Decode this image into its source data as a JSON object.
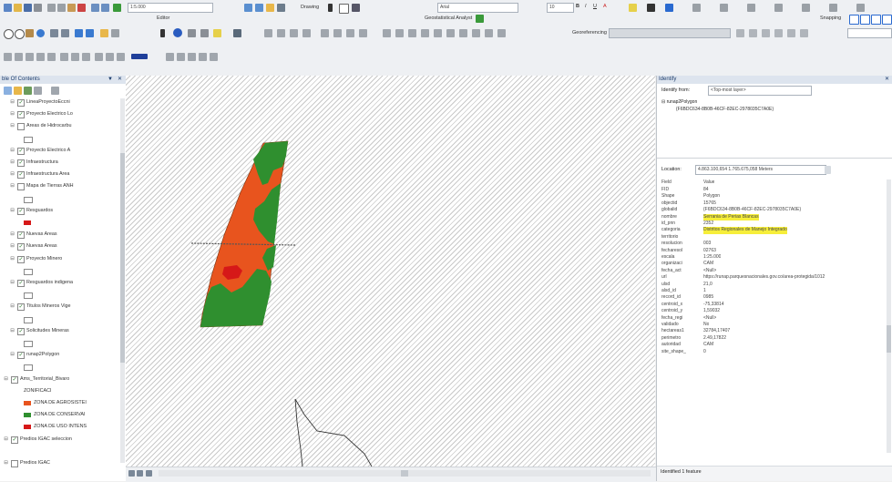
{
  "toolbar": {
    "scale": "1:5.000",
    "drawing_label": "Drawing",
    "font_value": "Arial",
    "font_size": "10",
    "editor_label": "Editor",
    "geostatistical_label": "Geostatistical Analyst",
    "snapping_label": "Snapping",
    "georeferencing_label": "Georeferencing"
  },
  "toc": {
    "title": "ble Of Contents",
    "layers": [
      {
        "label": "LineaProyectoEccni",
        "checked": true,
        "expanded": true,
        "indent": 1
      },
      {
        "label": "Proyecto Electrico Lo",
        "checked": true,
        "expanded": true,
        "indent": 1
      },
      {
        "label": "Areas de Hidrocarbu",
        "checked": false,
        "expanded": true,
        "indent": 1
      },
      {
        "label": "",
        "checked": null,
        "expanded": null,
        "indent": 2,
        "symbol": "outline"
      },
      {
        "label": "Proyecto Electrico A",
        "checked": true,
        "expanded": true,
        "indent": 1
      },
      {
        "label": "Infraestructura",
        "checked": true,
        "expanded": true,
        "indent": 1
      },
      {
        "label": "Infraestructura Area",
        "checked": true,
        "expanded": true,
        "indent": 1
      },
      {
        "label": "Mapa de Tierras ANH",
        "checked": false,
        "expanded": true,
        "indent": 1
      },
      {
        "label": "",
        "checked": null,
        "expanded": null,
        "indent": 2,
        "symbol": "outline"
      },
      {
        "label": "Resguardos",
        "checked": true,
        "expanded": true,
        "indent": 1
      },
      {
        "label": "",
        "checked": null,
        "expanded": null,
        "indent": 2,
        "symbol": "red"
      },
      {
        "label": "Nuevas Areas",
        "checked": true,
        "expanded": true,
        "indent": 1
      },
      {
        "label": "Nuevas Areas",
        "checked": true,
        "expanded": true,
        "indent": 1
      },
      {
        "label": "Proyecto Minero",
        "checked": true,
        "expanded": true,
        "indent": 1
      },
      {
        "label": "",
        "checked": null,
        "expanded": null,
        "indent": 2,
        "symbol": "outline"
      },
      {
        "label": "Resguardos indigena",
        "checked": true,
        "expanded": true,
        "indent": 1
      },
      {
        "label": "",
        "checked": null,
        "expanded": null,
        "indent": 2,
        "symbol": "outline"
      },
      {
        "label": "Titulos Mineros Vige",
        "checked": true,
        "expanded": true,
        "indent": 1
      },
      {
        "label": "",
        "checked": null,
        "expanded": null,
        "indent": 2,
        "symbol": "outline"
      },
      {
        "label": "Solicitudes Mineras",
        "checked": true,
        "expanded": true,
        "indent": 1
      },
      {
        "label": "",
        "checked": null,
        "expanded": null,
        "indent": 2,
        "symbol": "outline"
      },
      {
        "label": "runap2Polygon",
        "checked": true,
        "expanded": true,
        "indent": 1
      },
      {
        "label": "",
        "checked": null,
        "expanded": null,
        "indent": 2,
        "symbol": "outline"
      },
      {
        "label": "Ams_Territorial_Bivaro",
        "checked": true,
        "expanded": true,
        "indent": 0
      },
      {
        "label": "ZONIFICACI",
        "checked": null,
        "expanded": null,
        "indent": 2,
        "symbol": null
      },
      {
        "label": "ZONA DE AGROSISTEI",
        "checked": null,
        "expanded": null,
        "indent": 2,
        "symbol": "orange"
      },
      {
        "label": "ZONA DE CONSERVAI",
        "checked": null,
        "expanded": null,
        "indent": 2,
        "symbol": "green"
      },
      {
        "label": "ZONA DE USO INTENS",
        "checked": null,
        "expanded": null,
        "indent": 2,
        "symbol": "red"
      },
      {
        "label": "Predios IGAC seleccion",
        "checked": true,
        "expanded": true,
        "indent": 0
      },
      {
        "label": "",
        "checked": null,
        "expanded": null,
        "indent": 0,
        "symbol": null
      },
      {
        "label": "Predios IGAC",
        "checked": false,
        "expanded": true,
        "indent": 0
      }
    ]
  },
  "identify": {
    "title": "Identify",
    "identify_from_label": "Identify from:",
    "identify_from_value": "<Top-most layer>",
    "tree_layer": "runap2Polygon",
    "tree_feature": "{F6BDC634-8B0B-46CF-82EC-2978035C7A0E}",
    "location_label": "Location:",
    "location_value": "4.863.100,654  1.765.675,058 Meters",
    "field_header": "Field",
    "value_header": "Value",
    "rows": [
      {
        "field": "FID",
        "value": "84"
      },
      {
        "field": "Shape",
        "value": "Polygon"
      },
      {
        "field": "objectid",
        "value": "15765"
      },
      {
        "field": "globalid",
        "value": "{F6BDC634-8B0B-46CF-82EC-2978035C7A0E}"
      },
      {
        "field": "nombre",
        "value": "Serrania de Perias Blancas",
        "highlight": true
      },
      {
        "field": "id_pnn",
        "value": "2352"
      },
      {
        "field": "categoria",
        "value": "Distritos Regionales de Manejo Integrado",
        "highlight": true
      },
      {
        "field": "territorio",
        "value": ""
      },
      {
        "field": "resolucion",
        "value": "003"
      },
      {
        "field": "fecharesol",
        "value": "02763"
      },
      {
        "field": "escala",
        "value": "1:25.000"
      },
      {
        "field": "organizaci",
        "value": "CAM"
      },
      {
        "field": "fecha_act",
        "value": "<Null>"
      },
      {
        "field": "url",
        "value": "https://runap.parquesnacionales.gov.co/area-protegida/1012"
      },
      {
        "field": "ulsd",
        "value": "21,0"
      },
      {
        "field": "alsd_id",
        "value": "1"
      },
      {
        "field": "record_id",
        "value": "0985"
      },
      {
        "field": "centroid_x",
        "value": "-75,33814"
      },
      {
        "field": "centroid_y",
        "value": "1,59032"
      },
      {
        "field": "fecha_regi",
        "value": "<Null>"
      },
      {
        "field": "validado",
        "value": "No"
      },
      {
        "field": "hectareas1",
        "value": "32784,17407"
      },
      {
        "field": "perimetro",
        "value": "2.49,17822"
      },
      {
        "field": "autoridad",
        "value": "CAM"
      },
      {
        "field": "site_shape_",
        "value": "0"
      }
    ],
    "footer": "Identified 1 feature"
  },
  "colors": {
    "agro": "#e8541e",
    "conservation": "#2f8f2f",
    "intensive": "#d61818",
    "highlight": "#f6ee3a"
  }
}
